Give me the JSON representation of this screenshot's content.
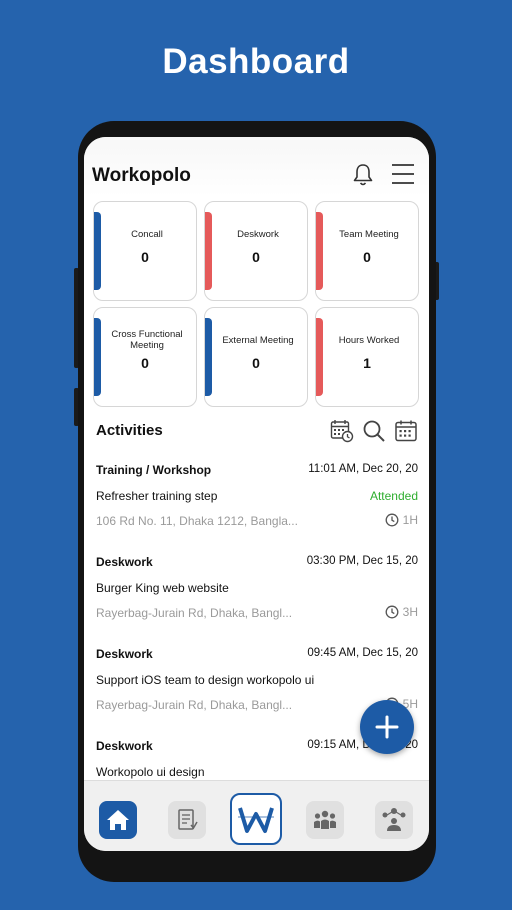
{
  "page": {
    "heading": "Dashboard"
  },
  "app": {
    "title": "Workopolo"
  },
  "stats": [
    {
      "label": "Concall",
      "value": "0",
      "accent": "#1d5ba6"
    },
    {
      "label": "Deskwork",
      "value": "0",
      "accent": "#e55a5a"
    },
    {
      "label": "Team Meeting",
      "value": "0",
      "accent": "#e55a5a"
    },
    {
      "label": "Cross Functional Meeting",
      "value": "0",
      "accent": "#1d5ba6"
    },
    {
      "label": "External Meeting",
      "value": "0",
      "accent": "#1d5ba6"
    },
    {
      "label": "Hours Worked",
      "value": "1",
      "accent": "#e55a5a"
    }
  ],
  "activities": {
    "title": "Activities",
    "items": [
      {
        "type": "Training / Workshop",
        "time": "11:01 AM, Dec 20, 20",
        "title": "Refresher training step",
        "status": "Attended",
        "address": "106 Rd No. 11, Dhaka 1212, Bangla...",
        "duration": "1H"
      },
      {
        "type": "Deskwork",
        "time": "03:30 PM, Dec 15, 20",
        "title": "Burger King web website",
        "status": "",
        "address": "Rayerbag-Jurain Rd, Dhaka, Bangl...",
        "duration": "3H"
      },
      {
        "type": "Deskwork",
        "time": "09:45 AM, Dec 15, 20",
        "title": "Support iOS team to design workopolo ui",
        "status": "",
        "address": "Rayerbag-Jurain Rd, Dhaka, Bangl...",
        "duration": "5H"
      },
      {
        "type": "Deskwork",
        "time": "09:15 AM, Dec 14, 20",
        "title": "Workopolo ui design",
        "status": "",
        "address": "",
        "duration": ""
      }
    ]
  },
  "colors": {
    "primary": "#1d5ba6",
    "accent_red": "#e55a5a",
    "success": "#2fae2f",
    "background": "#2563ad"
  },
  "icons": {
    "header": [
      "bell-icon",
      "menu-icon"
    ],
    "activities": [
      "calendar-clock-icon",
      "search-icon",
      "calendar-icon"
    ],
    "nav": [
      "home-icon",
      "report-icon",
      "workopolo-logo-icon",
      "team-icon",
      "network-icon"
    ]
  }
}
